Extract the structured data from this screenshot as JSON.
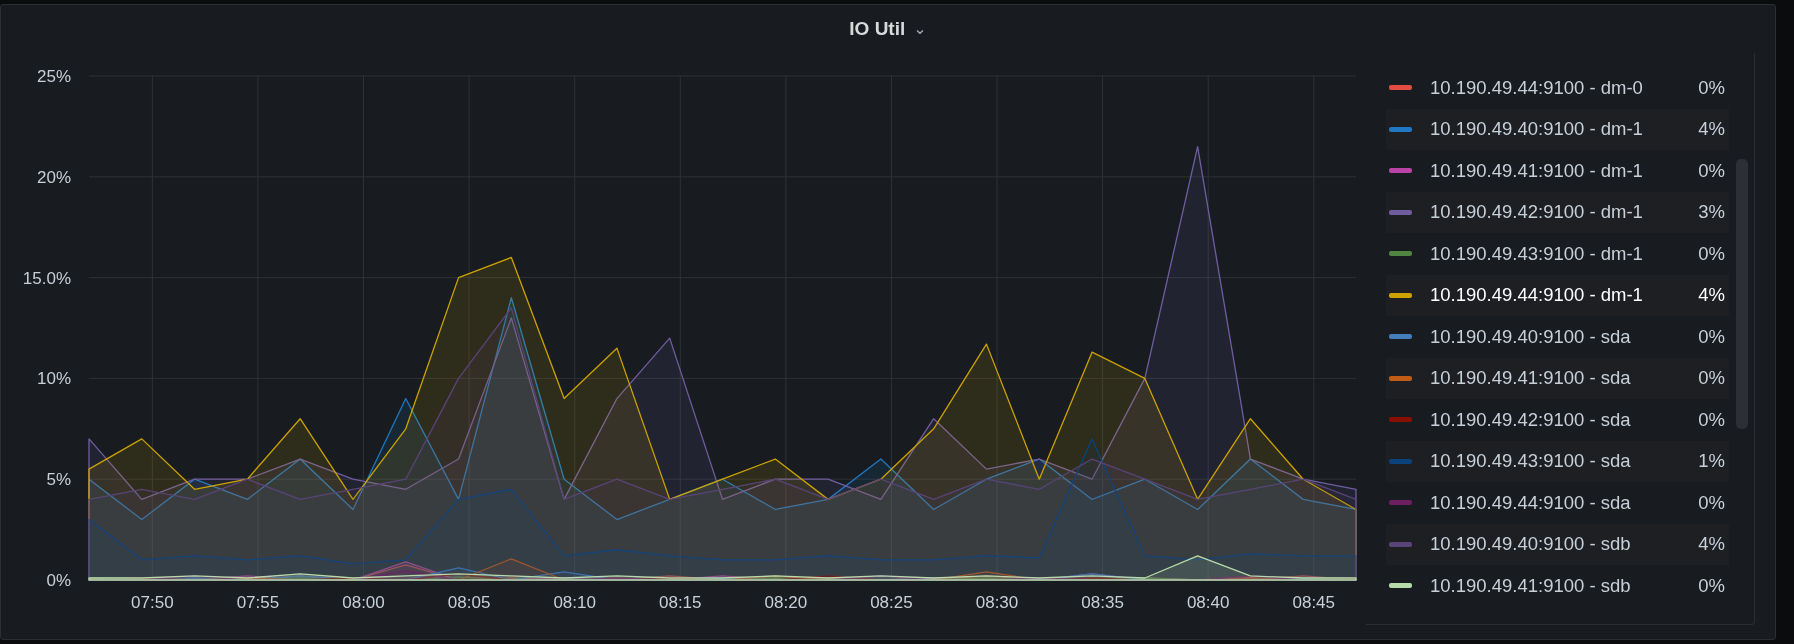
{
  "panel": {
    "title": "IO Util",
    "menu_caret": "⌄"
  },
  "chart_data": {
    "type": "area",
    "x": [
      467,
      469.5,
      472,
      474.5,
      477,
      479.5,
      482,
      484.5,
      487,
      489.5,
      492,
      494.5,
      497,
      499.5,
      502,
      504.5,
      507,
      509.5,
      512,
      514.5,
      517,
      519.5,
      522,
      524.5,
      527
    ],
    "xlim": [
      467,
      527
    ],
    "ylim": [
      0,
      25
    ],
    "grid": true,
    "xticks": [
      {
        "value": 470,
        "label": "07:50"
      },
      {
        "value": 475,
        "label": "07:55"
      },
      {
        "value": 480,
        "label": "08:00"
      },
      {
        "value": 485,
        "label": "08:05"
      },
      {
        "value": 490,
        "label": "08:10"
      },
      {
        "value": 495,
        "label": "08:15"
      },
      {
        "value": 500,
        "label": "08:20"
      },
      {
        "value": 505,
        "label": "08:25"
      },
      {
        "value": 510,
        "label": "08:30"
      },
      {
        "value": 515,
        "label": "08:35"
      },
      {
        "value": 520,
        "label": "08:40"
      },
      {
        "value": 525,
        "label": "08:45"
      }
    ],
    "yticks": [
      {
        "value": 0,
        "label": "0%"
      },
      {
        "value": 5,
        "label": "5%"
      },
      {
        "value": 10,
        "label": "10%"
      },
      {
        "value": 15,
        "label": "15.0%"
      },
      {
        "value": 20,
        "label": "20%"
      },
      {
        "value": 25,
        "label": "25%"
      }
    ],
    "series": [
      {
        "name": "10.190.49.44:9100 - dm-0",
        "color": "#e24d42",
        "values": [
          0,
          0.1,
          0,
          0,
          0.2,
          0,
          0.75,
          0,
          0.1,
          0,
          0,
          0.2,
          0,
          0,
          0.1,
          0,
          0,
          0.2,
          0,
          0,
          0.1,
          0,
          0,
          0.2,
          0
        ]
      },
      {
        "name": "10.190.49.40:9100 - dm-1",
        "color": "#1f78c1",
        "values": [
          5,
          3,
          5,
          4,
          6,
          3.5,
          9,
          4,
          14,
          5,
          3,
          4,
          5,
          3.5,
          4,
          6,
          3.5,
          5,
          6,
          4,
          5,
          3.5,
          6,
          4,
          3.5
        ]
      },
      {
        "name": "10.190.49.41:9100 - dm-1",
        "color": "#ba43a9",
        "values": [
          0.1,
          0,
          0,
          0.2,
          0,
          0,
          0.9,
          0,
          0,
          0.1,
          0,
          0,
          0.2,
          0,
          0,
          0,
          0.1,
          0,
          0,
          0.3,
          0,
          0,
          0.1,
          0,
          0
        ]
      },
      {
        "name": "10.190.49.42:9100 - dm-1",
        "color": "#705da0",
        "values": [
          7,
          4,
          5,
          5,
          6,
          5,
          4.5,
          6,
          13,
          4,
          9,
          12,
          4,
          5,
          5,
          4,
          8,
          5.5,
          6,
          5,
          10,
          21.5,
          6,
          5,
          4.5
        ]
      },
      {
        "name": "10.190.49.43:9100 - dm-1",
        "color": "#508642",
        "values": [
          0.1,
          0.1,
          0,
          0,
          0.1,
          0,
          0,
          0.15,
          0,
          0,
          0.1,
          0,
          0,
          0.1,
          0,
          0,
          0,
          0.1,
          0,
          0,
          0.1,
          0,
          0,
          0.1,
          0.1
        ]
      },
      {
        "name": "10.190.49.44:9100 - dm-1",
        "color": "#cca300",
        "values": [
          5.5,
          7,
          4.5,
          5,
          8,
          4,
          7.5,
          15,
          16,
          9,
          11.5,
          4,
          5,
          6,
          4,
          5,
          7.5,
          11.7,
          5,
          11.3,
          10,
          4,
          8,
          5,
          3.5
        ]
      },
      {
        "name": "10.190.49.40:9100 - sda",
        "color": "#447ebc",
        "values": [
          0,
          0,
          0.1,
          0,
          0.2,
          0,
          0,
          0.6,
          0,
          0.4,
          0,
          0,
          0.1,
          0,
          0,
          0.2,
          0,
          0,
          0,
          0.3,
          0,
          0,
          0,
          0.1,
          0
        ]
      },
      {
        "name": "10.190.49.41:9100 - sda",
        "color": "#c15c17",
        "values": [
          0,
          0,
          0,
          0.1,
          0,
          0,
          0,
          0,
          1.05,
          0,
          0,
          0,
          0,
          0.2,
          0,
          0,
          0,
          0.4,
          0,
          0,
          0,
          0,
          0.1,
          0,
          0
        ]
      },
      {
        "name": "10.190.49.42:9100 - sda",
        "color": "#890f02",
        "values": [
          0,
          0.1,
          0,
          0,
          0,
          0.1,
          0,
          0.3,
          0,
          0,
          0,
          0.1,
          0,
          0,
          0.2,
          0,
          0,
          0,
          0,
          0.1,
          0,
          0,
          0,
          0,
          0.1
        ]
      },
      {
        "name": "10.190.49.43:9100 - sda",
        "color": "#0a437c",
        "values": [
          3,
          1,
          1.2,
          1,
          1.2,
          0.8,
          1,
          4,
          4.5,
          1.2,
          1.5,
          1.2,
          1,
          1,
          1.2,
          1,
          1,
          1.2,
          1.1,
          7,
          1.2,
          1,
          1.3,
          1.2,
          1.2
        ]
      },
      {
        "name": "10.190.49.44:9100 - sda",
        "color": "#6d1f62",
        "values": [
          0,
          0,
          0.2,
          0,
          0,
          0,
          0.45,
          0,
          0,
          0,
          0.1,
          0,
          0,
          0,
          0,
          0.2,
          0,
          0,
          0.1,
          0,
          0,
          0,
          0.2,
          0,
          0
        ]
      },
      {
        "name": "10.190.49.40:9100 - sdb",
        "color": "#584477",
        "values": [
          4,
          4.5,
          4,
          5,
          4,
          4.5,
          5,
          10,
          13.5,
          4,
          5,
          4,
          4.5,
          5,
          4,
          5,
          4,
          5,
          4.5,
          6,
          5,
          4,
          4.5,
          5,
          4
        ]
      },
      {
        "name": "10.190.49.41:9100 - sdb",
        "color": "#b7dbab",
        "values": [
          0.1,
          0.1,
          0.2,
          0.1,
          0.3,
          0.1,
          0.2,
          0.3,
          0.2,
          0.1,
          0.2,
          0.1,
          0.1,
          0.2,
          0.1,
          0.2,
          0.1,
          0.2,
          0.1,
          0.2,
          0.1,
          1.2,
          0.2,
          0.1,
          0.1
        ]
      }
    ]
  },
  "legend": [
    {
      "value": "0%",
      "highlighted": false
    },
    {
      "value": "4%",
      "highlighted": false
    },
    {
      "value": "0%",
      "highlighted": false
    },
    {
      "value": "3%",
      "highlighted": false
    },
    {
      "value": "0%",
      "highlighted": false
    },
    {
      "value": "4%",
      "highlighted": true
    },
    {
      "value": "0%",
      "highlighted": false
    },
    {
      "value": "0%",
      "highlighted": false
    },
    {
      "value": "0%",
      "highlighted": false
    },
    {
      "value": "1%",
      "highlighted": false
    },
    {
      "value": "0%",
      "highlighted": false
    },
    {
      "value": "4%",
      "highlighted": false
    },
    {
      "value": "0%",
      "highlighted": false
    }
  ]
}
